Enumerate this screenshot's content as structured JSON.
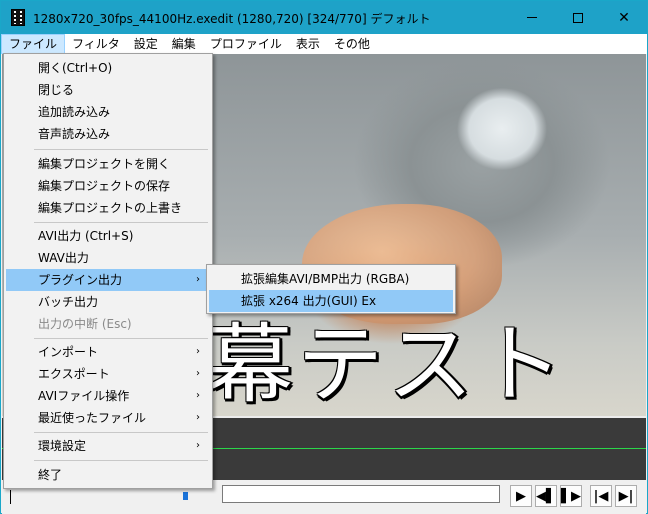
{
  "window": {
    "title": "1280x720_30fps_44100Hz.exedit (1280,720)  [324/770]  デフォルト",
    "minimize_glyph": "",
    "close_glyph": "✕",
    "accent": "#1ea2c8"
  },
  "menubar": {
    "items": [
      "ファイル",
      "フィルタ",
      "設定",
      "編集",
      "プロファイル",
      "表示",
      "その他"
    ],
    "active_index": 0
  },
  "video": {
    "subtitle": "幕テスト"
  },
  "file_menu": {
    "items": [
      {
        "label": "開く(Ctrl+O)"
      },
      {
        "label": "閉じる"
      },
      {
        "label": "追加読み込み"
      },
      {
        "label": "音声読み込み"
      },
      {
        "label": "編集プロジェクトを開く"
      },
      {
        "label": "編集プロジェクトの保存"
      },
      {
        "label": "編集プロジェクトの上書き"
      },
      {
        "label": "AVI出力 (Ctrl+S)"
      },
      {
        "label": "WAV出力"
      },
      {
        "label": "プラグイン出力",
        "submenu": true,
        "highlighted": true
      },
      {
        "label": "バッチ出力"
      },
      {
        "label": "出力の中断 (Esc)",
        "disabled": true
      },
      {
        "label": "インポート",
        "submenu": true
      },
      {
        "label": "エクスポート",
        "submenu": true
      },
      {
        "label": "AVIファイル操作",
        "submenu": true
      },
      {
        "label": "最近使ったファイル",
        "submenu": true
      },
      {
        "label": "環境設定",
        "submenu": true
      },
      {
        "label": "終了"
      }
    ],
    "submenu_arrow": "›"
  },
  "plugin_submenu": {
    "items": [
      {
        "label": "拡張編集AVI/BMP出力 (RGBA)"
      },
      {
        "label": "拡張 x264 出力(GUI) Ex",
        "highlighted": true
      }
    ]
  },
  "controls": {
    "buttons": [
      {
        "name": "play-button",
        "glyph": "▶"
      },
      {
        "name": "prev-frame-button",
        "glyph": "◀▌"
      },
      {
        "name": "next-frame-button",
        "glyph": "▌▶"
      },
      {
        "name": "first-frame-button",
        "glyph": "|◀"
      },
      {
        "name": "last-frame-button",
        "glyph": "▶|"
      }
    ]
  }
}
